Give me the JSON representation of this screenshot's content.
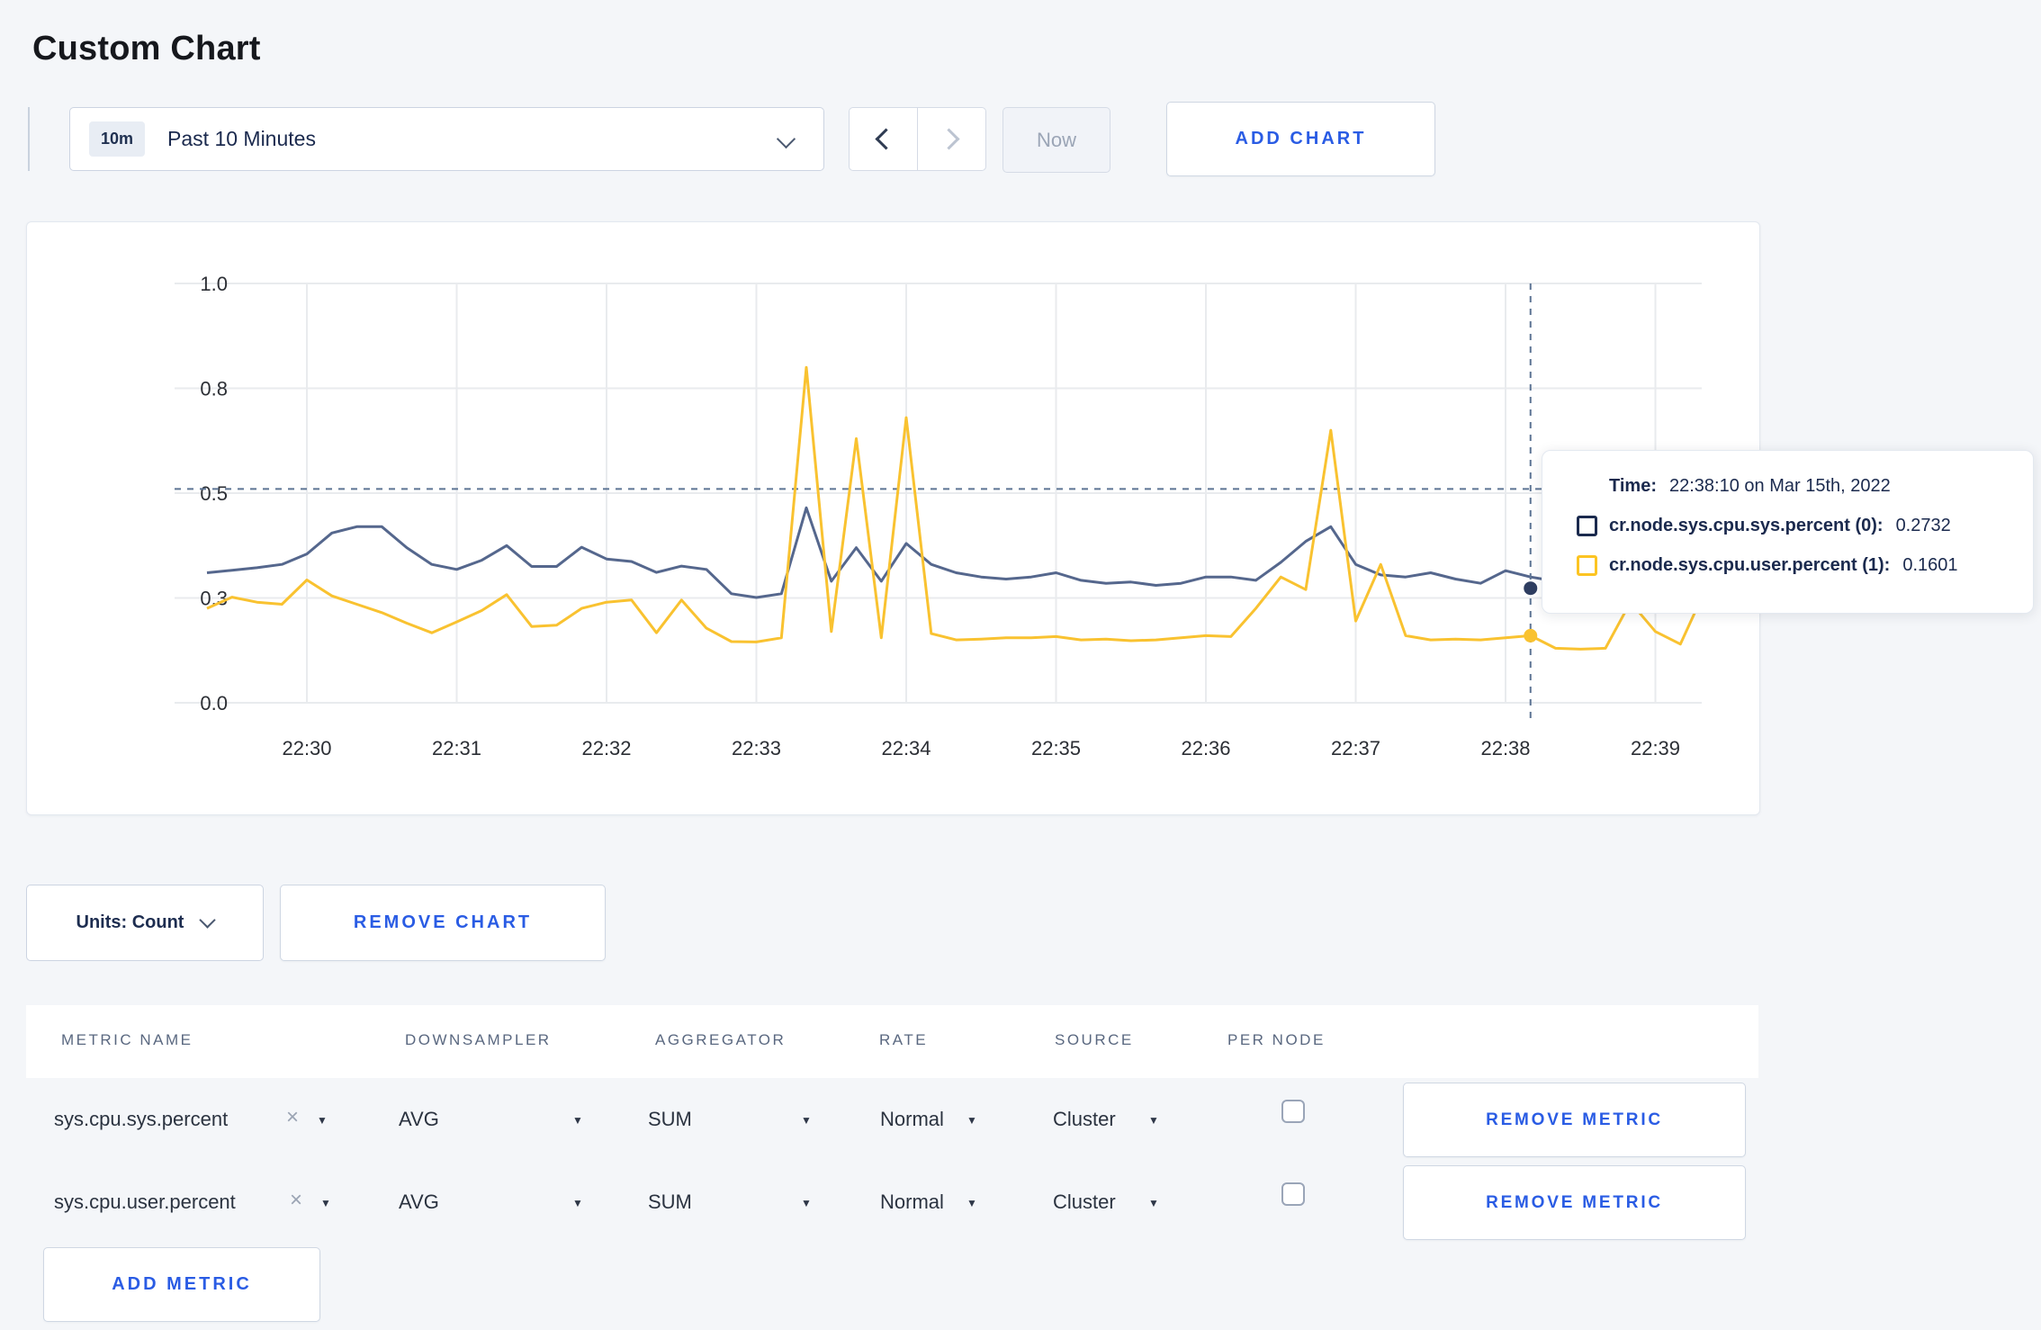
{
  "page": {
    "title": "Custom Chart",
    "background_color": "#f4f6f9",
    "accent_color": "#2a5ce4"
  },
  "toolbar": {
    "time_range": {
      "badge": "10m",
      "label": "Past 10 Minutes"
    },
    "now_label": "Now",
    "add_chart_label": "ADD CHART"
  },
  "tooltip": {
    "time_label": "Time:",
    "time_value": "22:38:10 on Mar 15th, 2022",
    "series": [
      {
        "label": "cr.node.sys.cpu.sys.percent (0):",
        "value": "0.2732",
        "marker_color": "#1b2a4e"
      },
      {
        "label": "cr.node.sys.cpu.user.percent (1):",
        "value": "0.1601",
        "marker_color": "#fcc422"
      }
    ]
  },
  "chart_controls": {
    "units_label": "Units: Count",
    "remove_chart_label": "REMOVE CHART",
    "remove_metric_label": "REMOVE METRIC",
    "add_metric_label": "ADD METRIC"
  },
  "metrics_table": {
    "columns": [
      "METRIC NAME",
      "DOWNSAMPLER",
      "AGGREGATOR",
      "RATE",
      "SOURCE",
      "PER NODE"
    ],
    "rows": [
      {
        "name": "sys.cpu.sys.percent",
        "downsampler": "AVG",
        "aggregator": "SUM",
        "rate": "Normal",
        "source": "Cluster",
        "per_node_checked": false
      },
      {
        "name": "sys.cpu.user.percent",
        "downsampler": "AVG",
        "aggregator": "SUM",
        "rate": "Normal",
        "source": "Cluster",
        "per_node_checked": false
      }
    ]
  },
  "chart_data": {
    "type": "line",
    "title": "",
    "x_start": "22:29:20",
    "x_step_seconds": 10,
    "x_ticks": [
      "22:30",
      "22:31",
      "22:32",
      "22:33",
      "22:34",
      "22:35",
      "22:36",
      "22:37",
      "22:38",
      "22:39"
    ],
    "y_ticks": [
      {
        "value": 0,
        "label": "0.0"
      },
      {
        "value": 0.25,
        "label": "0.3"
      },
      {
        "value": 0.5,
        "label": "0.5"
      },
      {
        "value": 0.75,
        "label": "0.8"
      },
      {
        "value": 1.0,
        "label": "1.0"
      }
    ],
    "ylim": [
      0,
      1
    ],
    "grid": true,
    "grid_color": "#e9ebee",
    "crosshair": {
      "time": "22:38:10",
      "x_index": 53,
      "y_value": 0.51,
      "color": "#5d7494"
    },
    "series": [
      {
        "name": "cr.node.sys.cpu.sys.percent",
        "color": "#55678d",
        "values": [
          0.31,
          0.316,
          0.322,
          0.33,
          0.355,
          0.405,
          0.42,
          0.42,
          0.37,
          0.33,
          0.318,
          0.34,
          0.375,
          0.325,
          0.325,
          0.371,
          0.343,
          0.337,
          0.311,
          0.326,
          0.318,
          0.26,
          0.251,
          0.26,
          0.465,
          0.29,
          0.37,
          0.29,
          0.38,
          0.33,
          0.31,
          0.3,
          0.295,
          0.3,
          0.31,
          0.292,
          0.285,
          0.288,
          0.28,
          0.285,
          0.3,
          0.3,
          0.292,
          0.335,
          0.385,
          0.42,
          0.33,
          0.305,
          0.3,
          0.31,
          0.295,
          0.285,
          0.315,
          0.3,
          0.29,
          0.298,
          0.3,
          0.295,
          0.3,
          0.298,
          0.3
        ]
      },
      {
        "name": "cr.node.sys.cpu.user.percent",
        "color": "#f9c230",
        "values": [
          0.225,
          0.252,
          0.24,
          0.235,
          0.293,
          0.255,
          0.235,
          0.215,
          0.19,
          0.167,
          0.193,
          0.22,
          0.258,
          0.182,
          0.185,
          0.225,
          0.24,
          0.245,
          0.167,
          0.245,
          0.178,
          0.146,
          0.145,
          0.155,
          0.8,
          0.17,
          0.63,
          0.155,
          0.68,
          0.165,
          0.15,
          0.152,
          0.155,
          0.155,
          0.158,
          0.15,
          0.152,
          0.148,
          0.15,
          0.155,
          0.16,
          0.158,
          0.225,
          0.3,
          0.27,
          0.65,
          0.195,
          0.33,
          0.16,
          0.15,
          0.152,
          0.15,
          0.155,
          0.16,
          0.13,
          0.128,
          0.13,
          0.24,
          0.17,
          0.14,
          0.27
        ]
      }
    ],
    "hover_dots": [
      {
        "series_index": 0,
        "x_index": 53,
        "value": 0.2732
      },
      {
        "series_index": 1,
        "x_index": 53,
        "value": 0.1601
      }
    ]
  }
}
